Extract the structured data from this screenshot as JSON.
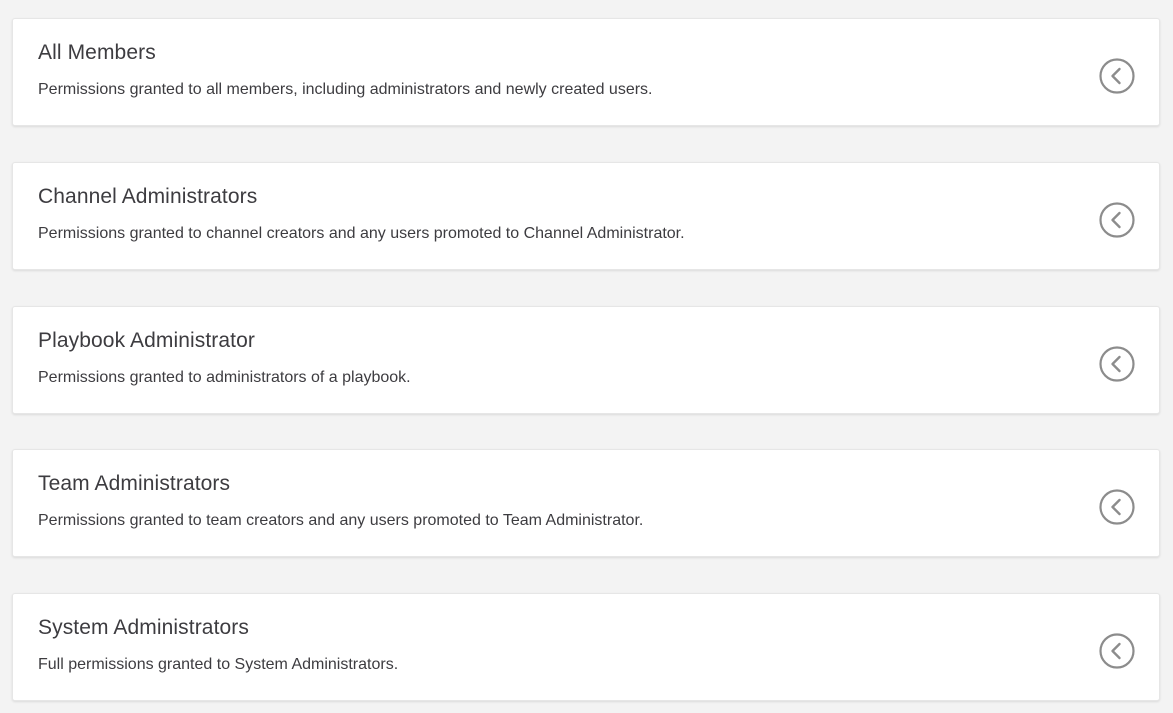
{
  "permission_schemes": [
    {
      "title": "All Members",
      "description": "Permissions granted to all members, including administrators and newly created users."
    },
    {
      "title": "Channel Administrators",
      "description": "Permissions granted to channel creators and any users promoted to Channel Administrator."
    },
    {
      "title": "Playbook Administrator",
      "description": "Permissions granted to administrators of a playbook."
    },
    {
      "title": "Team Administrators",
      "description": "Permissions granted to team creators and any users promoted to Team Administrator."
    },
    {
      "title": "System Administrators",
      "description": "Full permissions granted to System Administrators."
    }
  ],
  "icons": {
    "toggle": "chevron-left-circle-icon"
  },
  "colors": {
    "background": "#f3f3f3",
    "panel": "#ffffff",
    "text": "#3d3c40",
    "icon": "#8c8c8c"
  }
}
